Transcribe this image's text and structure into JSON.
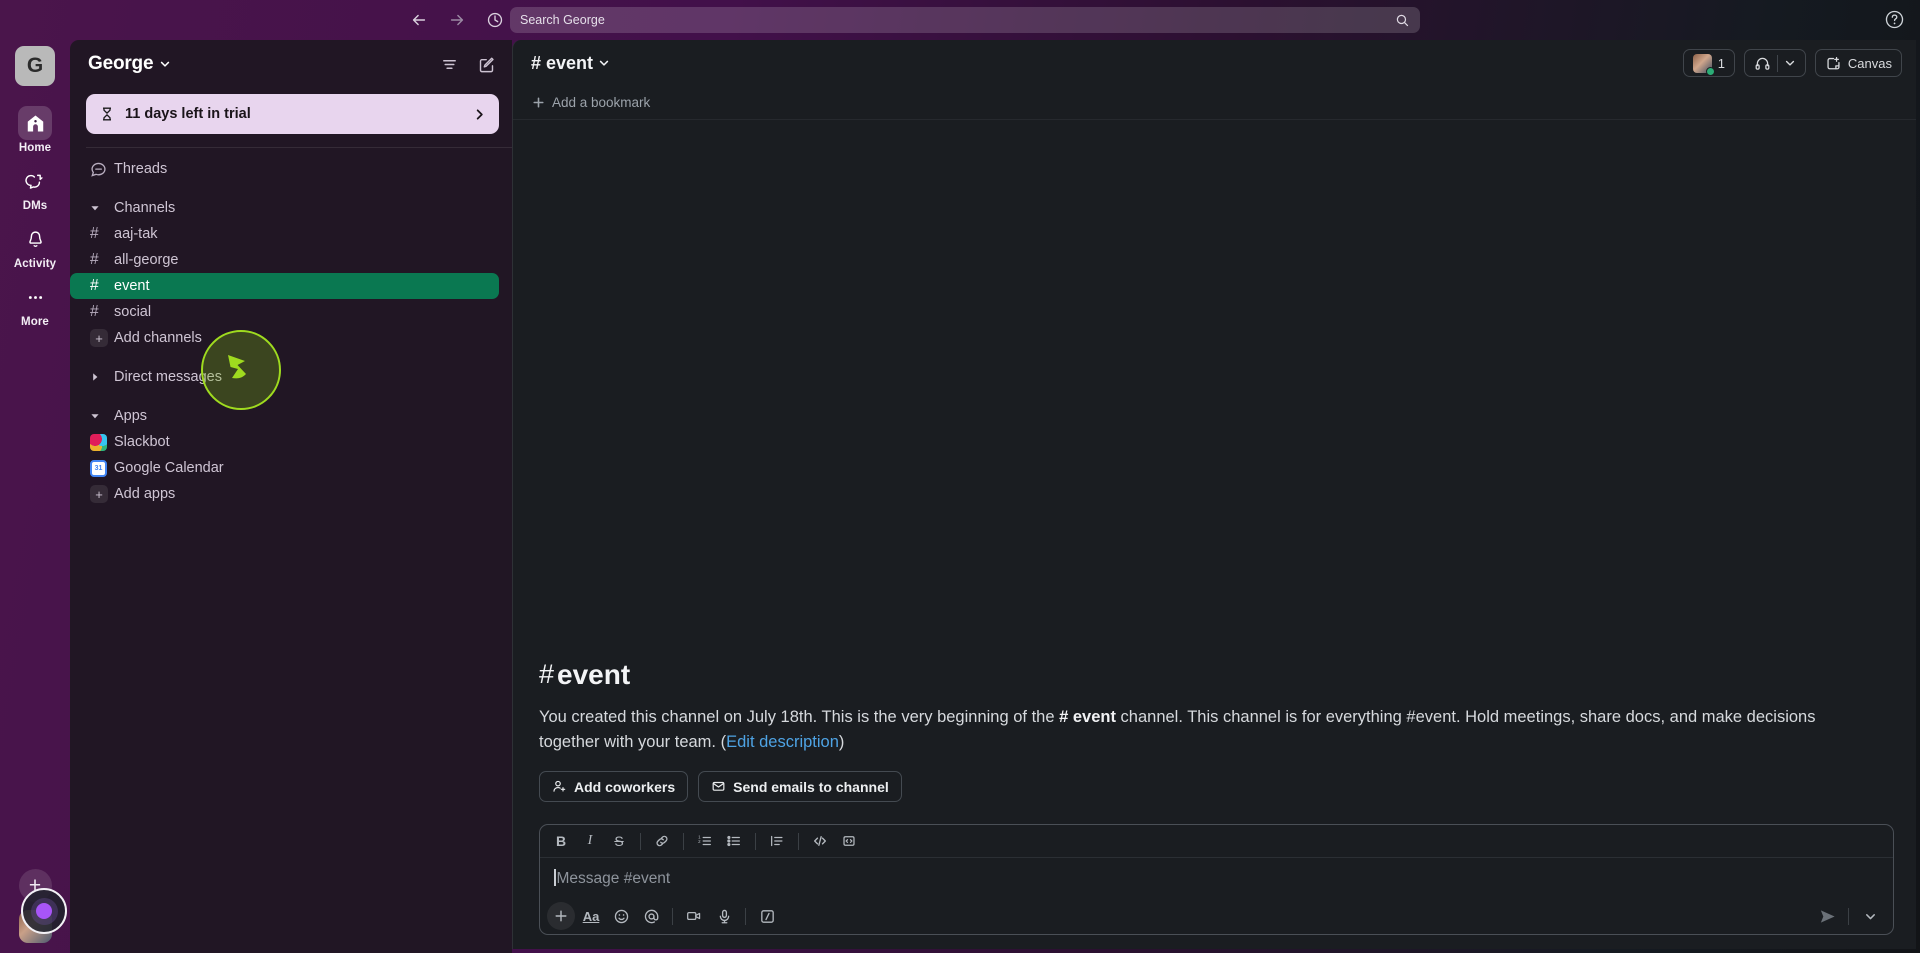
{
  "topbar": {
    "back_icon": "arrow-left-icon",
    "forward_icon": "arrow-right-icon",
    "history_icon": "clock-icon",
    "search_placeholder": "Search George",
    "search_icon": "magnifier-icon",
    "help_icon": "question-circle-icon"
  },
  "rail": {
    "workspace_initial": "G",
    "items": [
      {
        "label": "Home",
        "icon": "home-icon",
        "active": true
      },
      {
        "label": "DMs",
        "icon": "dms-icon",
        "active": false
      },
      {
        "label": "Activity",
        "icon": "bell-icon",
        "active": false
      },
      {
        "label": "More",
        "icon": "ellipsis-icon",
        "active": false
      }
    ],
    "new_icon": "plus-icon",
    "avatar_name": "user-avatar"
  },
  "sidebar": {
    "workspace_name": "George",
    "filter_icon": "filter-icon",
    "compose_icon": "compose-icon",
    "trial": {
      "icon": "hourglass-icon",
      "text": "11 days left in trial",
      "chevron": "chevron-right-icon"
    },
    "threads_label": "Threads",
    "sections": {
      "channels_label": "Channels",
      "direct_messages_label": "Direct messages",
      "apps_label": "Apps"
    },
    "channels": [
      {
        "name": "aaj-tak",
        "selected": false
      },
      {
        "name": "all-george",
        "selected": false
      },
      {
        "name": "event",
        "selected": true
      },
      {
        "name": "social",
        "selected": false
      }
    ],
    "add_channels_label": "Add channels",
    "apps": [
      {
        "name": "Slackbot",
        "icon": "slackbot-icon"
      },
      {
        "name": "Google Calendar",
        "icon": "google-calendar-icon"
      }
    ],
    "add_apps_label": "Add apps",
    "selected_color": "#0a7851",
    "background_color": "#211624"
  },
  "channel": {
    "name": "event",
    "hash": "#",
    "chevron": "chevron-down-icon",
    "member_count": "1",
    "headphones_icon": "headphones-icon",
    "huddle_chevron": "chevron-down-icon",
    "canvas_label": "Canvas",
    "canvas_icon": "canvas-icon",
    "bookmark_add_label": "Add a bookmark",
    "bookmark_add_icon": "plus-icon"
  },
  "intro": {
    "title": "event",
    "hash": "#",
    "text_part1": "You created this channel on July 18th. This is the very beginning of the ",
    "channel_mention": "# event",
    "text_part2": " channel. This channel is for everything #event. Hold meetings, share docs, and make decisions together with your team. (",
    "edit_link": "Edit description",
    "text_part3": ")",
    "add_coworkers_label": "Add coworkers",
    "add_coworkers_icon": "person-plus-icon",
    "send_emails_label": "Send emails to channel",
    "send_emails_icon": "envelope-icon"
  },
  "composer": {
    "placeholder": "Message #event",
    "format_buttons": [
      {
        "name": "bold-button",
        "glyph": "B"
      },
      {
        "name": "italic-button",
        "glyph": "I"
      },
      {
        "name": "strikethrough-button",
        "glyph": "S"
      },
      {
        "name": "link-button",
        "glyph": "link-icon"
      },
      {
        "name": "ordered-list-button",
        "glyph": "ordered-list-icon"
      },
      {
        "name": "bulleted-list-button",
        "glyph": "bulleted-list-icon"
      },
      {
        "name": "blockquote-button",
        "glyph": "blockquote-icon"
      },
      {
        "name": "code-button",
        "glyph": "code-icon"
      },
      {
        "name": "code-block-button",
        "glyph": "code-block-icon"
      }
    ],
    "action_buttons": [
      {
        "name": "attach-button",
        "glyph": "plus-icon"
      },
      {
        "name": "formatting-button",
        "glyph": "Aa"
      },
      {
        "name": "emoji-button",
        "glyph": "smiley-icon"
      },
      {
        "name": "mention-button",
        "glyph": "at-icon"
      },
      {
        "name": "video-button",
        "glyph": "video-icon"
      },
      {
        "name": "audio-button",
        "glyph": "microphone-icon"
      },
      {
        "name": "slash-command-button",
        "glyph": "slash-icon"
      }
    ],
    "send_icon": "send-icon",
    "send_options_icon": "chevron-down-icon"
  },
  "cursor": {
    "pointer_icon": "mouse-pointer-arrow",
    "highlight_color": "#9fdb1f"
  }
}
